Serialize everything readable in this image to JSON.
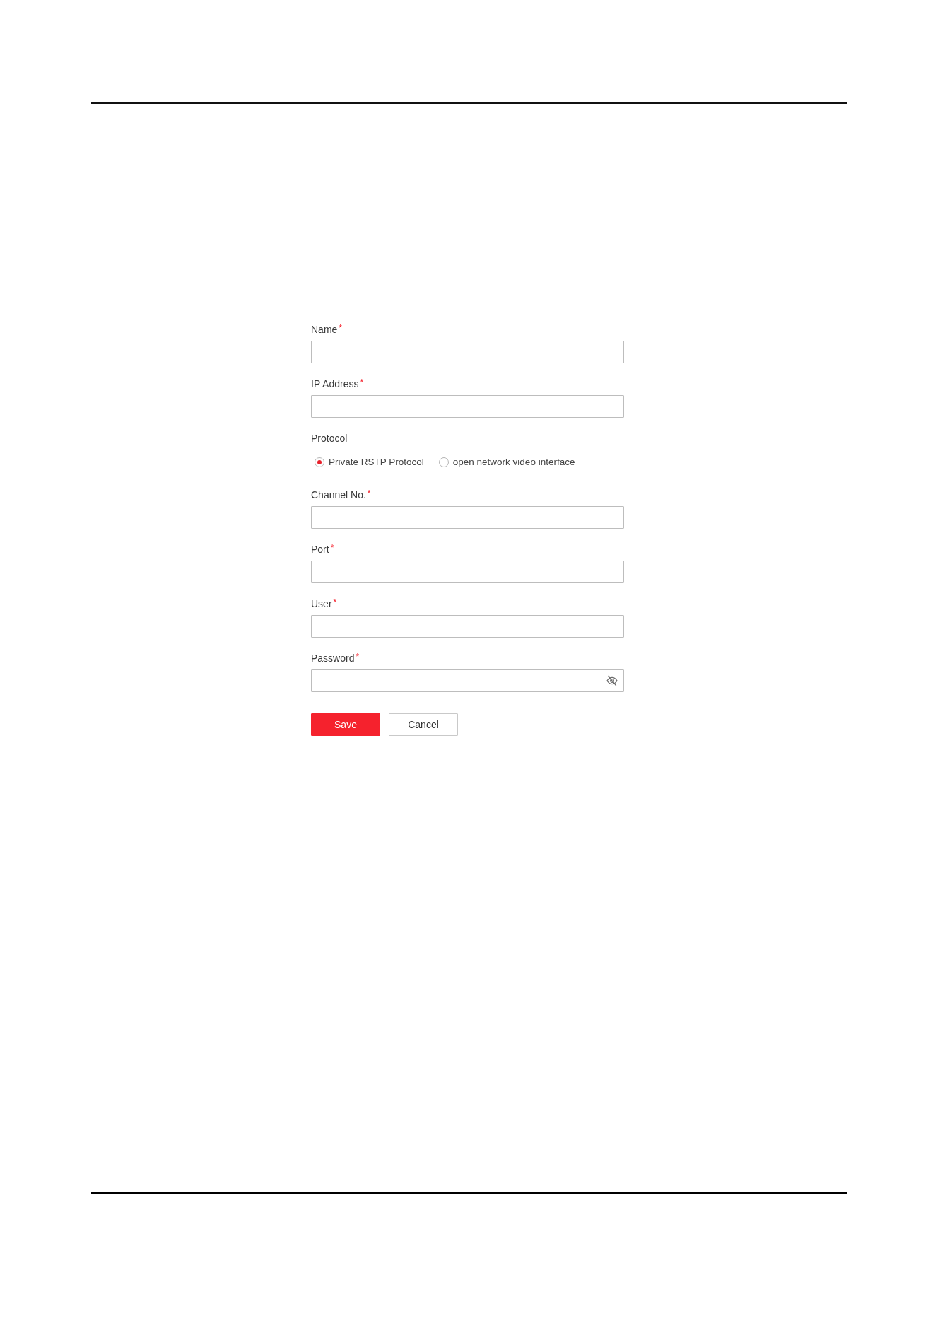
{
  "form": {
    "fields": [
      {
        "kind": "text",
        "label": "Name",
        "required_mark": "*"
      },
      {
        "kind": "text",
        "label": "IP Address",
        "required_mark": "*"
      },
      {
        "kind": "radio",
        "label": "Protocol",
        "options": [
          {
            "label": "Private RSTP Protocol",
            "selected": true
          },
          {
            "label": "open network video interface",
            "selected": false
          }
        ]
      },
      {
        "kind": "text",
        "label": "Channel No.",
        "required_mark": "*"
      },
      {
        "kind": "text",
        "label": "Port",
        "required_mark": "*"
      },
      {
        "kind": "text",
        "label": "User",
        "required_mark": "*"
      },
      {
        "kind": "password",
        "label": "Password",
        "required_mark": "*"
      }
    ],
    "buttons": [
      {
        "kind": "primary",
        "label": "Save"
      },
      {
        "kind": "secondary",
        "label": "Cancel"
      }
    ]
  }
}
